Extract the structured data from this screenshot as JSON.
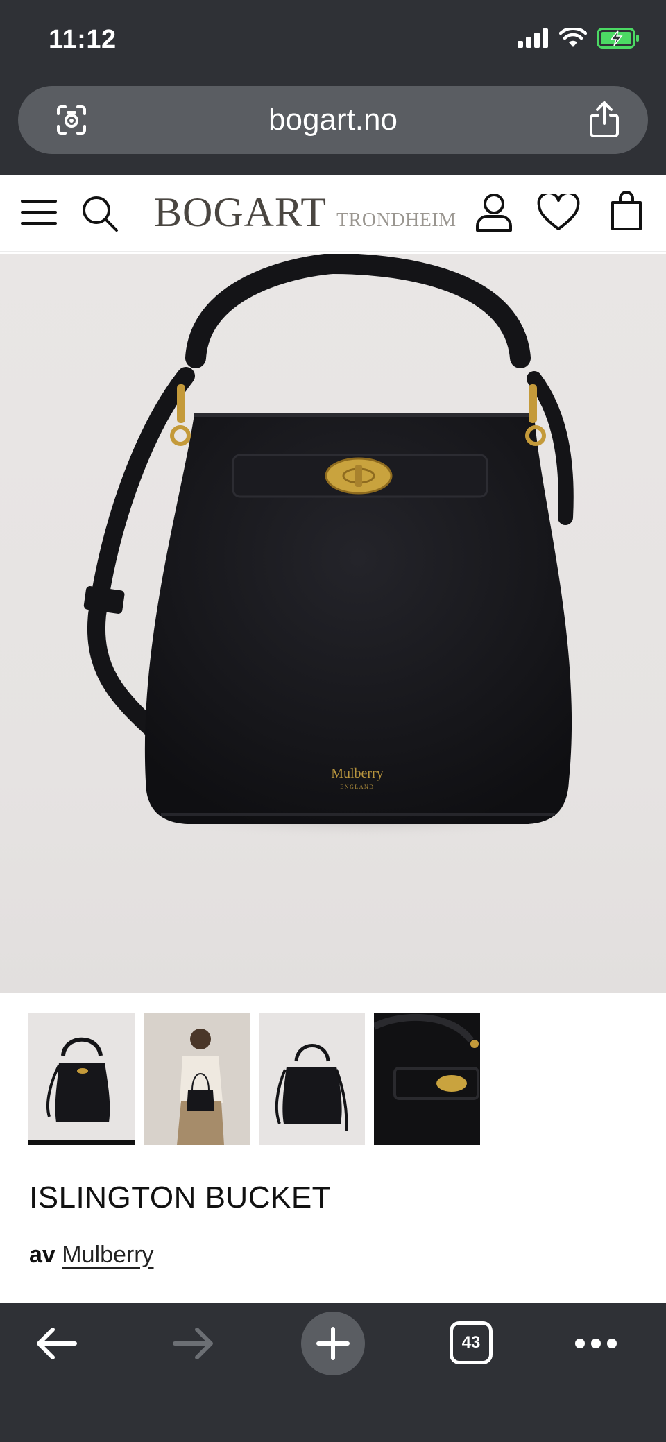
{
  "status_bar": {
    "time": "11:12"
  },
  "browser": {
    "url": "bogart.no",
    "tab_count": "43"
  },
  "site": {
    "logo_main": "BOGART",
    "logo_sub": "TRONDHEIM"
  },
  "product": {
    "bag_label": "Mulberry",
    "bag_sublabel": "ENGLAND",
    "title": "ISLINGTON BUCKET",
    "by_prefix": "av",
    "brand": "Mulberry",
    "thumbnails": [
      "thumbnail-1",
      "thumbnail-2",
      "thumbnail-3",
      "thumbnail-4"
    ],
    "active_thumbnail": 1
  },
  "colors": {
    "browser_chrome": "#2f3136",
    "address_bar": "#5a5d62",
    "battery": "#4cd964",
    "logo": "#4a4641",
    "bag": "#16161a",
    "hardware": "#c49a3a"
  },
  "icons": [
    "camera-search-icon",
    "share-icon",
    "menu-icon",
    "search-icon",
    "account-icon",
    "wishlist-icon",
    "cart-icon",
    "back-icon",
    "forward-icon",
    "plus-icon",
    "more-icon"
  ]
}
